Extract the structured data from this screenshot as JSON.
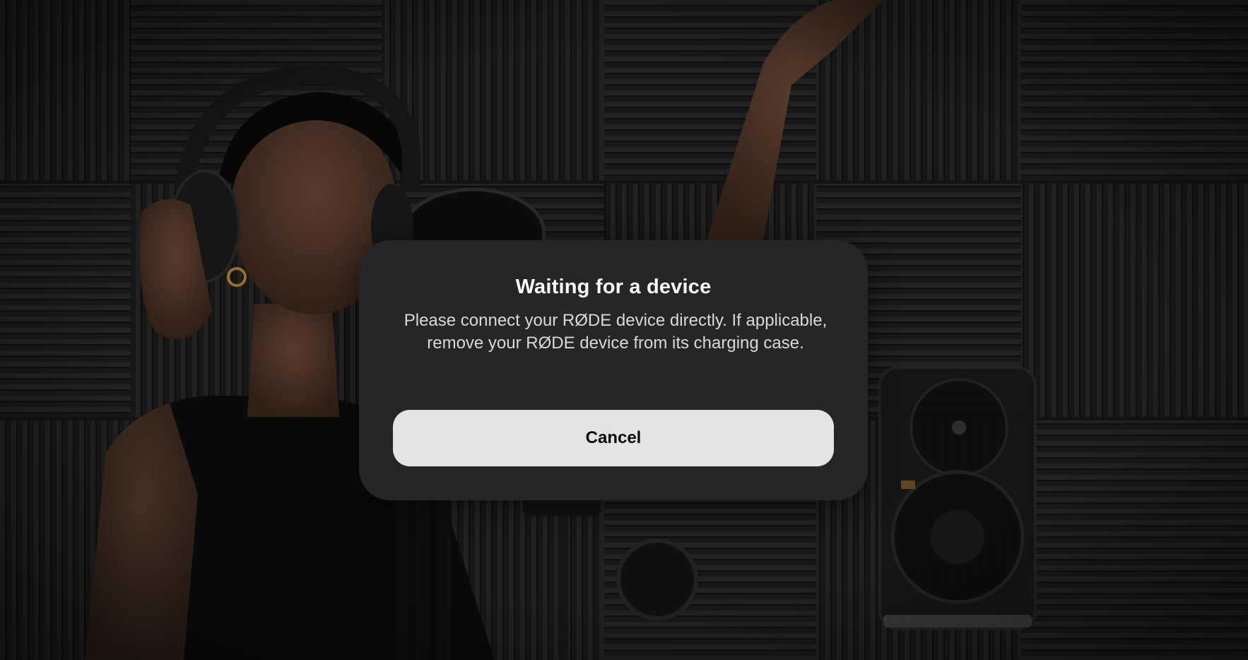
{
  "background": {
    "description_icon": "studio-photo"
  },
  "dialog": {
    "title": "Waiting for a device",
    "message": "Please connect your RØDE device directly. If applicable, remove your RØDE device from its charging case.",
    "cancel_label": "Cancel"
  },
  "colors": {
    "dialog_bg": "#262628",
    "button_bg": "#e4e4e6",
    "title_text": "#ffffff",
    "body_text": "#d9d9dc"
  }
}
